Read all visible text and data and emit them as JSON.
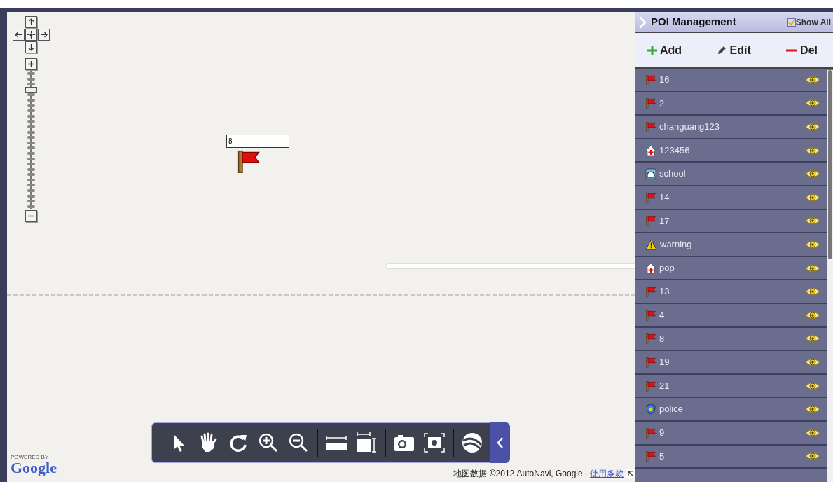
{
  "map": {
    "zoom": {
      "level": 0.88
    },
    "marker_label": "8",
    "attribution": {
      "text": "地图数据 ©2012 AutoNavi, Google - ",
      "link": "使用条款"
    },
    "logo": {
      "caption": "POWERED BY",
      "brand": "Google"
    }
  },
  "panel": {
    "title": "POI Management",
    "show_all": {
      "label": "Show All",
      "checked": true
    },
    "actions": [
      {
        "kind": "add",
        "label": "Add"
      },
      {
        "kind": "edit",
        "label": "Edit"
      },
      {
        "kind": "del",
        "label": "Del"
      }
    ],
    "items": [
      {
        "kind": "flag",
        "label": "16"
      },
      {
        "kind": "flag",
        "label": "2"
      },
      {
        "kind": "flag",
        "label": "changuang123"
      },
      {
        "kind": "hospital",
        "label": "123456"
      },
      {
        "kind": "school",
        "label": "school"
      },
      {
        "kind": "flag",
        "label": "14"
      },
      {
        "kind": "flag",
        "label": "17"
      },
      {
        "kind": "warning",
        "label": "warning"
      },
      {
        "kind": "hospital",
        "label": "pop"
      },
      {
        "kind": "flag",
        "label": "13"
      },
      {
        "kind": "flag",
        "label": "4"
      },
      {
        "kind": "flag",
        "label": "8"
      },
      {
        "kind": "flag",
        "label": "19"
      },
      {
        "kind": "flag",
        "label": "21"
      },
      {
        "kind": "police",
        "label": "police"
      },
      {
        "kind": "flag",
        "label": "9"
      },
      {
        "kind": "flag",
        "label": "5"
      }
    ]
  }
}
